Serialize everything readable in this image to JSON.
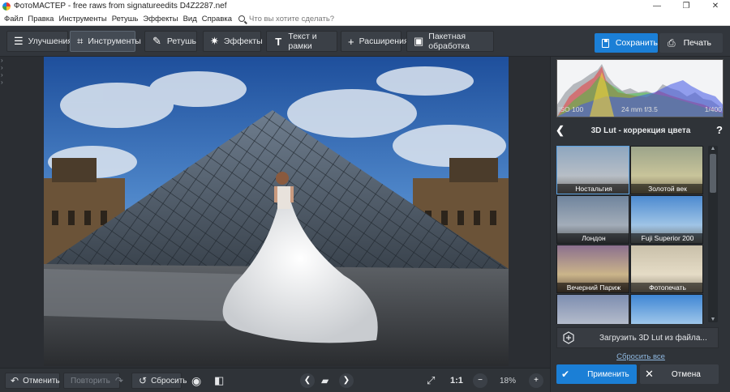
{
  "window": {
    "title": "ФотоМАСТЕР - free raws from signatureedits D4Z2287.nef",
    "controls": [
      "—",
      "❐",
      "✕"
    ]
  },
  "menu": {
    "items": [
      "Файл",
      "Правка",
      "Инструменты",
      "Ретушь",
      "Эффекты",
      "Вид",
      "Справка"
    ],
    "search_placeholder": "Что вы хотите сделать?"
  },
  "toolbar": {
    "tabs": [
      {
        "label": "Улучшения",
        "icon": "sliders-icon"
      },
      {
        "label": "Инструменты",
        "icon": "crop-icon",
        "active": true
      },
      {
        "label": "Ретушь",
        "icon": "brush-icon"
      },
      {
        "label": "Эффекты",
        "icon": "sparkle-icon"
      },
      {
        "label": "Текст и рамки",
        "icon": "text-icon"
      },
      {
        "label": "Расширения",
        "icon": "plus-icon"
      },
      {
        "label": "Пакетная обработка",
        "icon": "batch-icon"
      }
    ],
    "save_label": "Сохранить",
    "print_label": "Печать"
  },
  "histogram": {
    "iso": "ISO 100",
    "lens": "24 mm f/3.5",
    "shutter": "1/400"
  },
  "lut_panel": {
    "title": "3D Lut - коррекция цвета",
    "back_glyph": "❮",
    "help_glyph": "?",
    "presets": [
      {
        "name": "Ностальгия",
        "selected": true
      },
      {
        "name": "Золотой век"
      },
      {
        "name": "Лондон"
      },
      {
        "name": "Fuji Superior 200"
      },
      {
        "name": "Вечерний Париж"
      },
      {
        "name": "Фотопечать"
      },
      {
        "name": ""
      },
      {
        "name": ""
      }
    ],
    "load_label": "Загрузить 3D Lut из файла...",
    "reset_all_label": "Сбросить все",
    "apply_label": "Применить",
    "cancel_label": "Отмена"
  },
  "bottombar": {
    "undo_label": "Отменить",
    "redo_label": "Повторить",
    "reset_label": "Сбросить",
    "zoom_one_label": "1:1",
    "zoom_value": "18%"
  },
  "colors": {
    "accent": "#1b7fd6",
    "panel": "#2f3338",
    "background": "#2b2e33"
  }
}
